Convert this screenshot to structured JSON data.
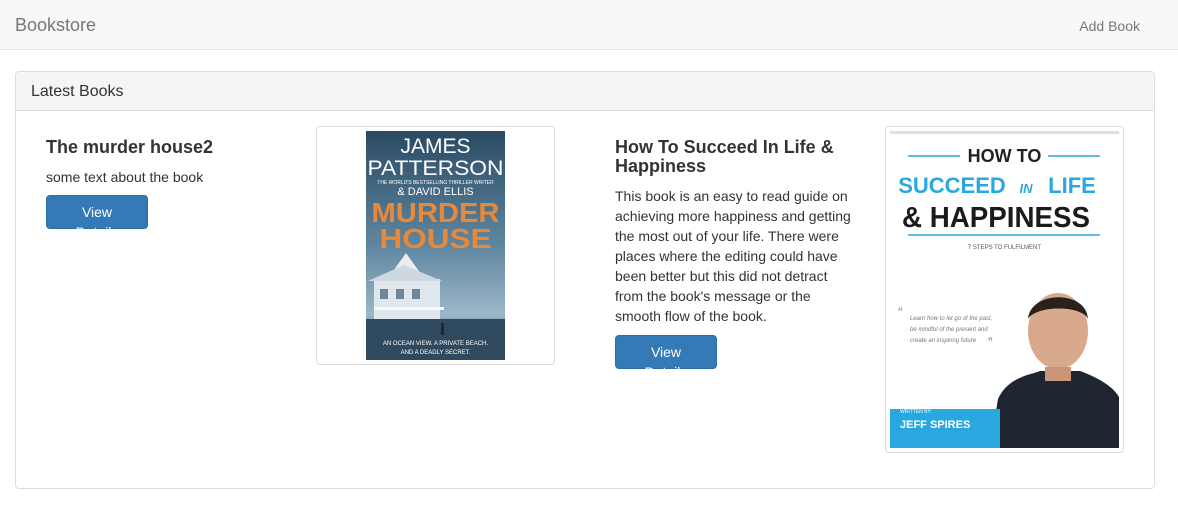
{
  "navbar": {
    "brand": "Bookstore",
    "add_book": "Add Book"
  },
  "panel": {
    "heading": "Latest Books"
  },
  "books": [
    {
      "title": "The murder house2",
      "description": "some text about the book",
      "button": "View Details",
      "cover": {
        "author_first": "JAMES",
        "author_last": "PATTERSON",
        "coauthor": "& DAVID ELLIS",
        "tagline_top": "THE WORLD'S BESTSELLING THRILLER WRITER",
        "title_line1": "MURDER",
        "title_line2": "HOUSE",
        "tagline_bottom_1": "AN OCEAN VIEW. A PRIVATE BEACH.",
        "tagline_bottom_2": "AND A DEADLY SECRET."
      }
    },
    {
      "title_line1": "How To Succeed In Life &",
      "title_line2": "Happiness",
      "description_lines": [
        "This book is an easy to read guide on",
        "achieving more happiness and getting",
        "the most out of your life. There were",
        "places where the editing could have",
        "been better but this did not detract",
        "from the book's message or the",
        "smooth flow of the book."
      ],
      "button": "View Details",
      "cover": {
        "line1": "HOW TO",
        "line2a": "SUCCEED",
        "line2b": "IN",
        "line2c": "LIFE",
        "line3": "& HAPPINESS",
        "subtitle": "7 STEPS TO FULFILMENT",
        "quote_1": "Learn how to let go of the past,",
        "quote_2": "be mindful of the present and",
        "quote_3": "create an inspiring future",
        "written_by": "WRITTEN BY:",
        "author": "JEFF SPIRES"
      }
    }
  ],
  "colors": {
    "button_bg": "#337ab7",
    "murder_orange": "#e8893a",
    "succeed_blue": "#29a8e0"
  }
}
